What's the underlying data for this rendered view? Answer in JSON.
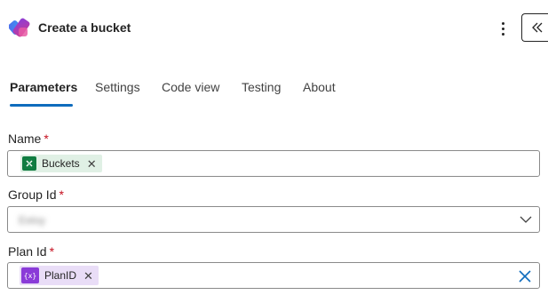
{
  "header": {
    "title": "Create a bucket",
    "icons": {
      "logo": "planner-logo",
      "more": "more-vertical-icon",
      "collapse": "double-chevron-left-icon"
    }
  },
  "tabs": [
    {
      "label": "Parameters",
      "active": true
    },
    {
      "label": "Settings",
      "active": false
    },
    {
      "label": "Code view",
      "active": false
    },
    {
      "label": "Testing",
      "active": false
    },
    {
      "label": "About",
      "active": false
    }
  ],
  "fields": {
    "name": {
      "label": "Name",
      "required_mark": "*",
      "token": "Buckets",
      "token_icon": "excel-icon"
    },
    "group_id": {
      "label": "Group Id",
      "required_mark": "*",
      "value": "Eeloy",
      "control": "dropdown"
    },
    "plan_id": {
      "label": "Plan Id",
      "required_mark": "*",
      "token": "PlanID",
      "token_icon": "expression-icon",
      "token_icon_text": "{x}"
    }
  },
  "colors": {
    "accent": "#0f6cbd",
    "required": "#c50f1f",
    "excel": "#107c41",
    "expression": "#8a3bd8"
  }
}
